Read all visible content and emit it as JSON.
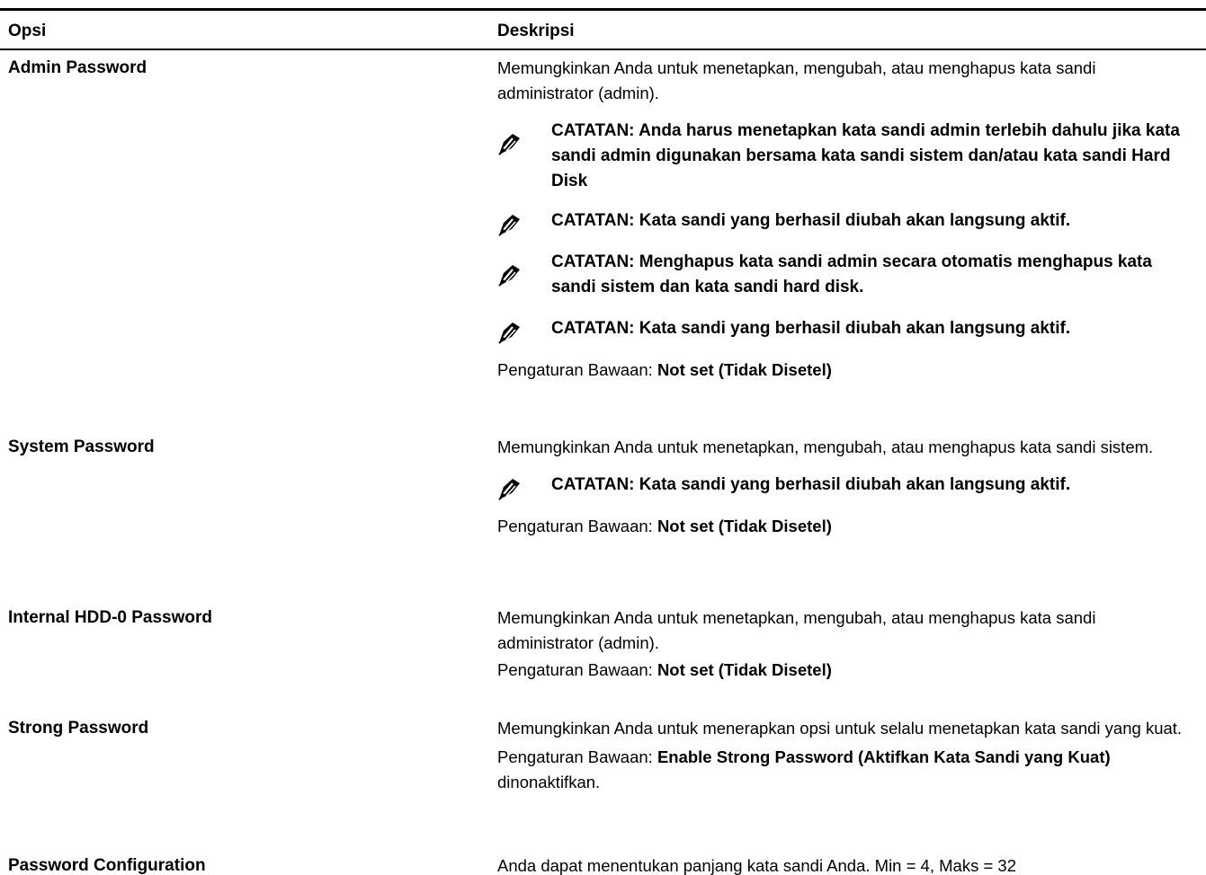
{
  "header": {
    "col_option": "Opsi",
    "col_description": "Deskripsi"
  },
  "rows": [
    {
      "option": "Admin Password",
      "description": "Memungkinkan Anda untuk menetapkan, mengubah, atau menghapus kata sandi administrator (admin).",
      "notes": [
        "CATATAN: Anda harus menetapkan kata sandi admin terlebih dahulu jika kata sandi admin digunakan bersama kata sandi sistem dan/atau kata sandi Hard Disk",
        "CATATAN: Kata sandi yang berhasil diubah akan langsung aktif.",
        "CATATAN: Menghapus kata sandi admin secara otomatis menghapus kata sandi sistem dan kata sandi hard disk.",
        "CATATAN: Kata sandi yang berhasil diubah akan langsung aktif."
      ],
      "default_label": "Pengaturan Bawaan: ",
      "default_value": "Not set (Tidak Disetel)"
    },
    {
      "option": "System Password",
      "description": "Memungkinkan Anda untuk menetapkan, mengubah, atau menghapus kata sandi sistem.",
      "notes": [
        "CATATAN: Kata sandi yang berhasil diubah akan langsung aktif."
      ],
      "default_label": "Pengaturan Bawaan: ",
      "default_value": "Not set (Tidak Disetel)"
    },
    {
      "option": "Internal HDD-0 Password",
      "description": "Memungkinkan Anda untuk menetapkan, mengubah, atau menghapus kata sandi administrator (admin).",
      "default_label": "Pengaturan Bawaan: ",
      "default_value": "Not set (Tidak Disetel)"
    },
    {
      "option": "Strong Password",
      "description": "Memungkinkan Anda untuk menerapkan opsi untuk selalu menetapkan kata sandi yang kuat.",
      "default_label": "Pengaturan Bawaan: ",
      "default_value": "Enable Strong Password (Aktifkan Kata Sandi yang Kuat)",
      "default_suffix": " dinonaktifkan."
    },
    {
      "option": "Password Configuration",
      "description": "Anda dapat menentukan panjang kata sandi Anda. Min = 4, Maks = 32"
    }
  ],
  "icons": {
    "note": "pencil-note-icon"
  }
}
